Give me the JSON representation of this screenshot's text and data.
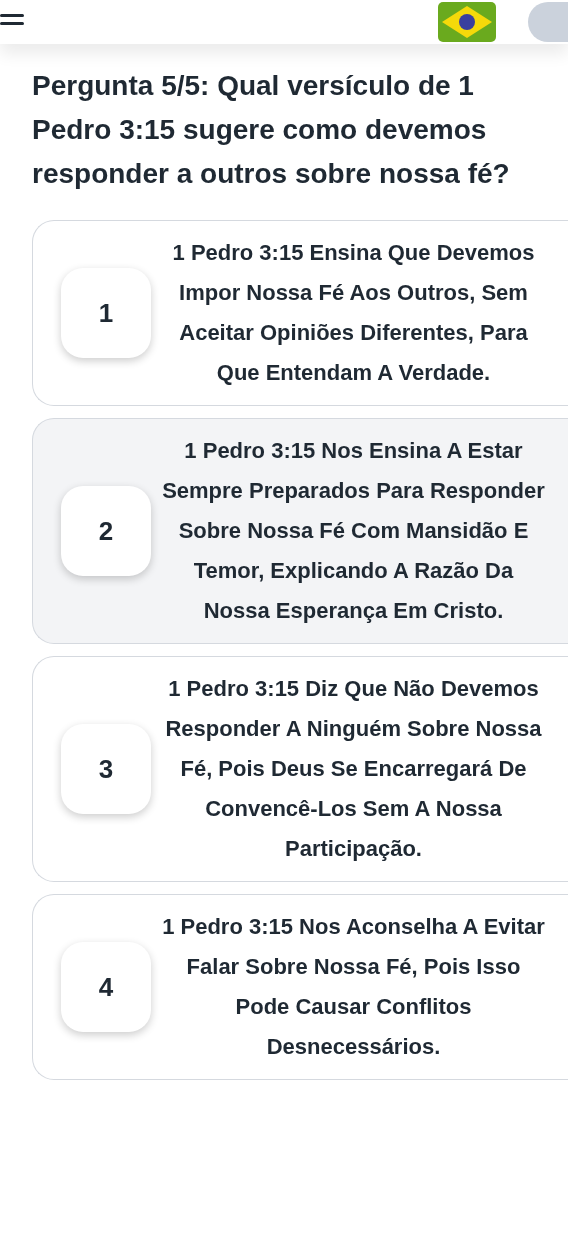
{
  "question": "Pergunta 5/5: Qual versículo de 1 Pedro 3:15 sugere como devemos responder a outros sobre nossa fé?",
  "options": [
    {
      "number": "1",
      "text": "1 Pedro 3:15 Ensina Que Devemos Impor Nossa Fé Aos Outros, Sem Aceitar Opiniões Diferentes, Para Que Entendam A Verdade.",
      "selected": false
    },
    {
      "number": "2",
      "text": "1 Pedro 3:15 Nos Ensina A Estar Sempre Preparados Para Responder Sobre Nossa Fé Com Mansidão E Temor, Explicando A Razão Da Nossa Esperança Em Cristo.",
      "selected": true
    },
    {
      "number": "3",
      "text": "1 Pedro 3:15 Diz Que Não Devemos Responder A Ninguém Sobre Nossa Fé, Pois Deus Se Encarregará De Convencê-Los Sem A Nossa Participação.",
      "selected": false
    },
    {
      "number": "4",
      "text": "1 Pedro 3:15 Nos Aconselha A Evitar Falar Sobre Nossa Fé, Pois Isso Pode Causar Conflitos Desnecessários.",
      "selected": false
    }
  ]
}
